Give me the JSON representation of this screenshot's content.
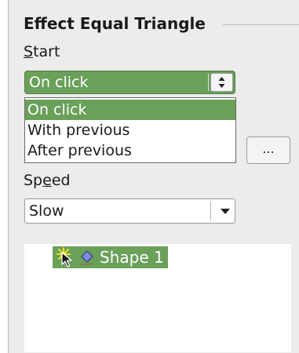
{
  "section": {
    "title": "Effect Equal Triangle"
  },
  "start": {
    "label_mnemonic": "S",
    "label_rest": "tart",
    "value": "On click",
    "options": [
      "On click",
      "With previous",
      "After previous"
    ],
    "selected_index": 0
  },
  "options_button": {
    "label": "..."
  },
  "speed": {
    "label_pre": "Sp",
    "label_mnemonic": "e",
    "label_post": "ed",
    "value": "Slow"
  },
  "effects_list": {
    "items": [
      {
        "label": "Shape 1",
        "icons": [
          "effect-sparkle-icon",
          "on-click-cursor-icon",
          "shape-icon"
        ]
      }
    ]
  },
  "colors": {
    "selection": "#6aa05a",
    "panel_bg": "#ececec",
    "list_bg": "#ffffff"
  }
}
